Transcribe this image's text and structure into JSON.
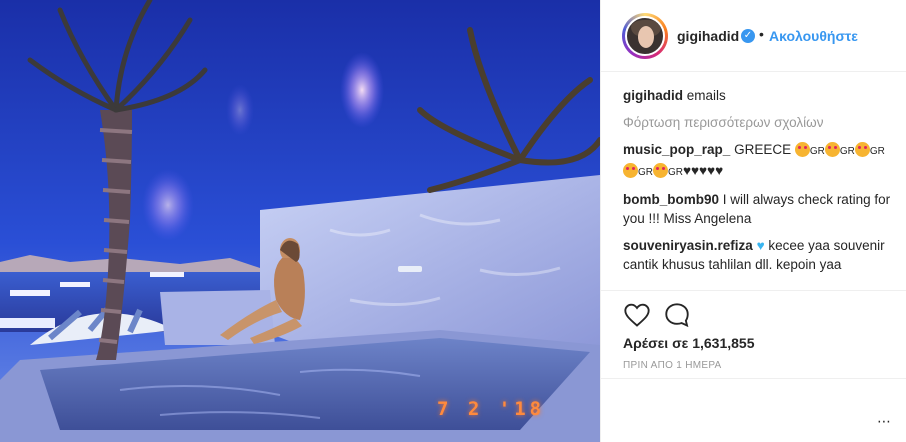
{
  "photo": {
    "date_stamp": "7 2 '18"
  },
  "header": {
    "username": "gigihadid",
    "verified_mark": "✓",
    "separator": "•",
    "follow_label": "Ακολουθήστε"
  },
  "comments": {
    "caption": {
      "user": "gigihadid",
      "text": "emails"
    },
    "load_more": "Φόρτωση περισσότερων σχολίων",
    "items": [
      {
        "user": "music_pop_rap_",
        "text": "GREECE",
        "gr": "GR",
        "hearts": "♥♥♥♥♥"
      },
      {
        "user": "bomb_bomb90",
        "text": "I will always check rating for you !!! Miss Angelena"
      },
      {
        "user": "souveniryasin.refiza",
        "heart": "♥",
        "text": "kecee yaa souvenir cantik khusus tahlilan dll. kepoin yaa"
      }
    ]
  },
  "actions": {
    "like_icon": "heart-icon",
    "comment_icon": "comment-bubble-icon"
  },
  "likes": "Αρέσει σε 1,631,855",
  "time": "ΠΡΙΝ ΑΠΟ 1 ΗΜΕΡΑ",
  "more_options": "⋯",
  "colors": {
    "link_blue": "#3897f0",
    "text": "#262626",
    "muted": "#999999",
    "border": "#efefef"
  }
}
